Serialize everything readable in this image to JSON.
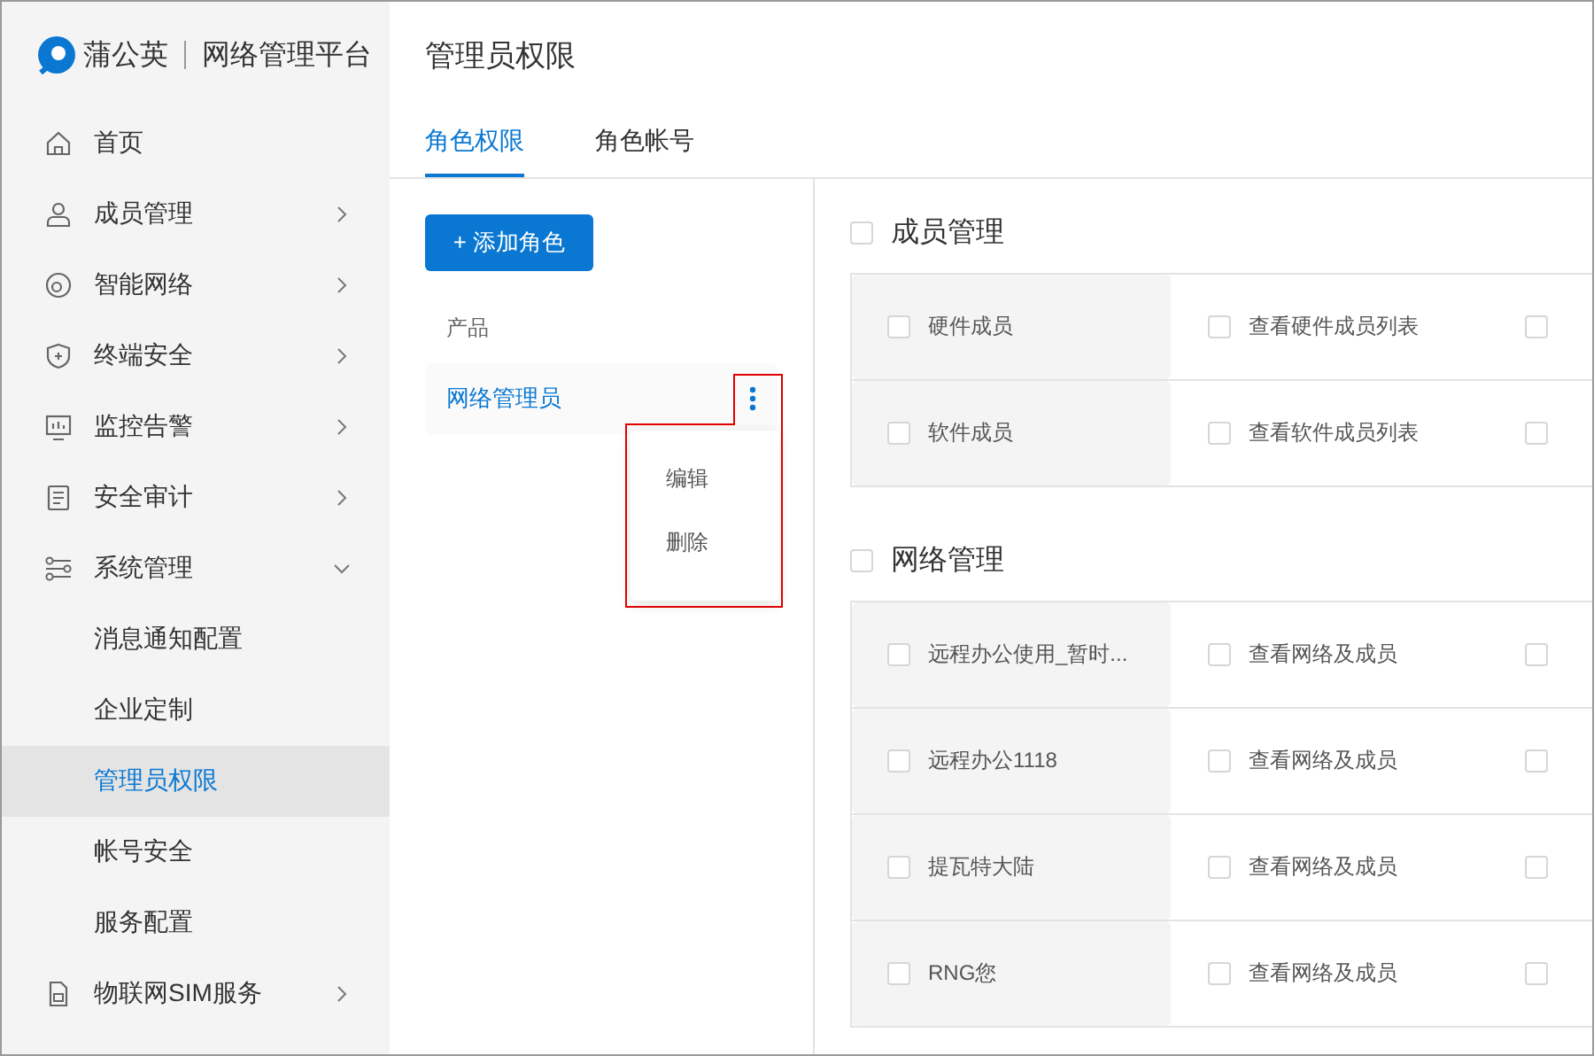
{
  "logo": {
    "brand": "蒲公英",
    "product": "网络管理平台"
  },
  "sidebar": {
    "items": [
      {
        "label": "首页",
        "selected": false
      },
      {
        "label": "成员管理",
        "expanded": false,
        "selected": false
      },
      {
        "label": "智能网络",
        "expanded": false,
        "selected": false
      },
      {
        "label": "终端安全",
        "expanded": false,
        "selected": false
      },
      {
        "label": "监控告警",
        "expanded": false,
        "selected": false
      },
      {
        "label": "安全审计",
        "expanded": false,
        "selected": false
      },
      {
        "label": "系统管理",
        "expanded": true,
        "selected": false,
        "children": [
          {
            "label": "消息通知配置",
            "selected": false
          },
          {
            "label": "企业定制",
            "selected": false
          },
          {
            "label": "管理员权限",
            "selected": true
          },
          {
            "label": "帐号安全",
            "selected": false
          },
          {
            "label": "服务配置",
            "selected": false
          }
        ]
      },
      {
        "label": "物联网SIM服务",
        "expanded": false,
        "selected": false
      }
    ]
  },
  "page_title": "管理员权限",
  "tabs": [
    {
      "label": "角色权限",
      "selected": true
    },
    {
      "label": "角色帐号",
      "selected": false
    }
  ],
  "add_button": "+ 添加角色",
  "role_group": "产品",
  "roles": [
    {
      "label": "网络管理员",
      "selected": true
    }
  ],
  "role_menu": [
    "编辑",
    "删除"
  ],
  "sections": [
    {
      "title": "成员管理",
      "checked": false,
      "rows": [
        {
          "name": "硬件成员",
          "checked": false,
          "permission": "查看硬件成员列表",
          "permission_checked": false,
          "column_3_checked": false
        },
        {
          "name": "软件成员",
          "checked": false,
          "permission": "查看软件成员列表",
          "permission_checked": false,
          "column_3_checked": false
        }
      ]
    },
    {
      "title": "网络管理",
      "checked": false,
      "rows": [
        {
          "name": "远程办公使用_暂时...",
          "checked": false,
          "permission": "查看网络及成员",
          "permission_checked": false,
          "column_3_checked": false
        },
        {
          "name": "远程办公1118",
          "checked": false,
          "permission": "查看网络及成员",
          "permission_checked": false,
          "column_3_checked": false
        },
        {
          "name": "提瓦特大陆",
          "checked": false,
          "permission": "查看网络及成员",
          "permission_checked": false,
          "column_3_checked": false
        },
        {
          "name": "RNG您",
          "checked": false,
          "permission": "查看网络及成员",
          "permission_checked": false,
          "column_3_checked": false
        }
      ]
    }
  ]
}
